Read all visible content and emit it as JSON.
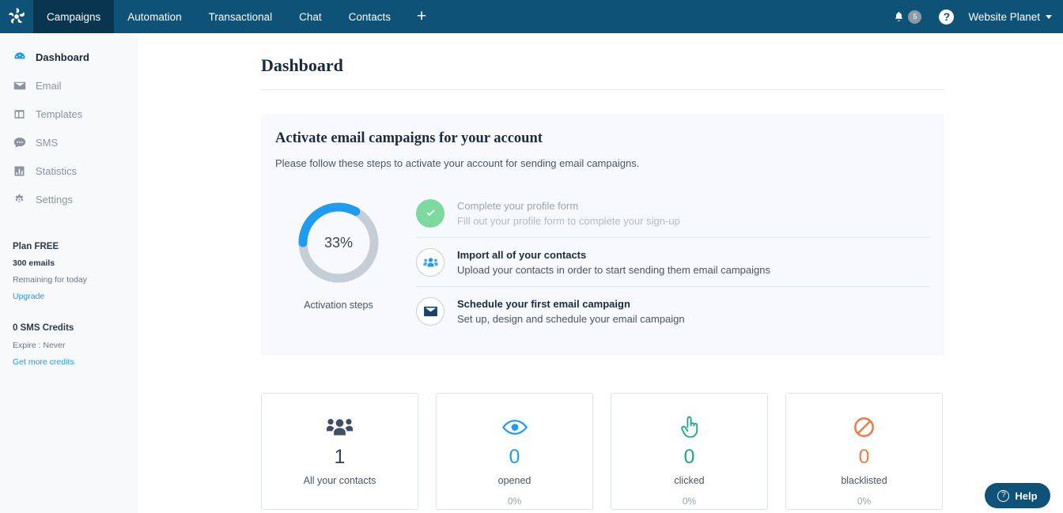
{
  "header": {
    "logo": "pinwheel-logo",
    "tabs": [
      {
        "label": "Campaigns",
        "active": true
      },
      {
        "label": "Automation",
        "active": false
      },
      {
        "label": "Transactional",
        "active": false
      },
      {
        "label": "Chat",
        "active": false
      },
      {
        "label": "Contacts",
        "active": false
      }
    ],
    "add_label": "+",
    "notification_count": "5",
    "help_label": "?",
    "account_name": "Website Planet"
  },
  "sidebar": {
    "items": [
      {
        "label": "Dashboard",
        "icon": "dashboard-icon",
        "active": true
      },
      {
        "label": "Email",
        "icon": "envelope-icon",
        "active": false
      },
      {
        "label": "Templates",
        "icon": "templates-icon",
        "active": false
      },
      {
        "label": "SMS",
        "icon": "chat-bubble-icon",
        "active": false
      },
      {
        "label": "Statistics",
        "icon": "bar-chart-icon",
        "active": false
      },
      {
        "label": "Settings",
        "icon": "gear-icon",
        "active": false
      }
    ],
    "plan": {
      "title": "Plan FREE",
      "emails": "300 emails",
      "remaining": "Remaining for today",
      "upgrade_link": "Upgrade"
    },
    "sms": {
      "title": "0 SMS Credits",
      "expire": "Expire : Never",
      "credits_link": "Get more credits"
    }
  },
  "main": {
    "page_title": "Dashboard",
    "panel": {
      "title": "Activate email campaigns for your account",
      "subtitle": "Please follow these steps to activate your account for sending email campaigns.",
      "progress": {
        "percent_label": "33%",
        "percent_value": 33,
        "label": "Activation steps",
        "arc_color": "#1f9bf0",
        "track_color": "#c5cdd6"
      },
      "steps": [
        {
          "title": "Complete your profile form",
          "desc": "Fill out your profile form to complete your sign-up",
          "icon": "check-icon",
          "state": "completed"
        },
        {
          "title": "Import all of your contacts",
          "desc": "Upload your contacts in order to start sending them email campaigns",
          "icon": "contacts-icon",
          "state": "pending"
        },
        {
          "title": "Schedule your first email campaign",
          "desc": "Set up, design and schedule your email campaign",
          "icon": "envelope-icon",
          "state": "pending"
        }
      ]
    },
    "cards": [
      {
        "icon": "people-group-icon",
        "value": "1",
        "label": "All your contacts",
        "percent": "",
        "color": "#414e62"
      },
      {
        "icon": "eye-icon",
        "value": "0",
        "label": "opened",
        "percent": "0%",
        "color": "#1f9bf0"
      },
      {
        "icon": "pointing-hand-icon",
        "value": "0",
        "label": "clicked",
        "percent": "0%",
        "color": "#1bab8a"
      },
      {
        "icon": "blocked-icon",
        "value": "0",
        "label": "blacklisted",
        "percent": "0%",
        "color": "#ef7a45"
      }
    ]
  },
  "help_widget": {
    "label": "Help",
    "icon_label": "?"
  }
}
